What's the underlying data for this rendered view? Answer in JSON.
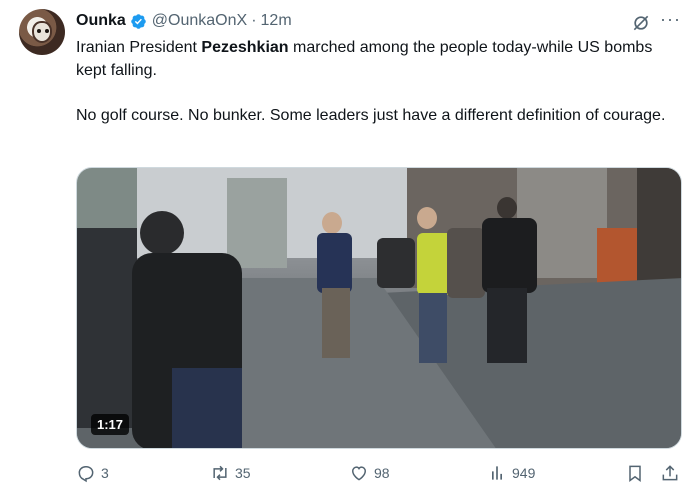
{
  "author": {
    "display_name": "Ounka",
    "handle": "@OunkaOnX",
    "separator": "·",
    "time": "12m",
    "verified_color": "#1d9bf0"
  },
  "tweet": {
    "line1_pre": "Iranian President ",
    "line1_bold": "Pezeshkian",
    "line1_post": " marched among the people today-while US bombs kept falling.",
    "paragraph2": "No golf course. No bunker. Some leaders just have a different definition of courage."
  },
  "media": {
    "duration": "1:17"
  },
  "actions": {
    "replies": "3",
    "reposts": "35",
    "likes": "98",
    "views": "949"
  },
  "icons": {
    "grok": "grok-icon",
    "more": "more-icon",
    "reply": "reply-icon",
    "repost": "repost-icon",
    "like": "heart-icon",
    "views": "views-icon",
    "bookmark": "bookmark-icon",
    "share": "share-icon"
  },
  "more_glyph": "···"
}
